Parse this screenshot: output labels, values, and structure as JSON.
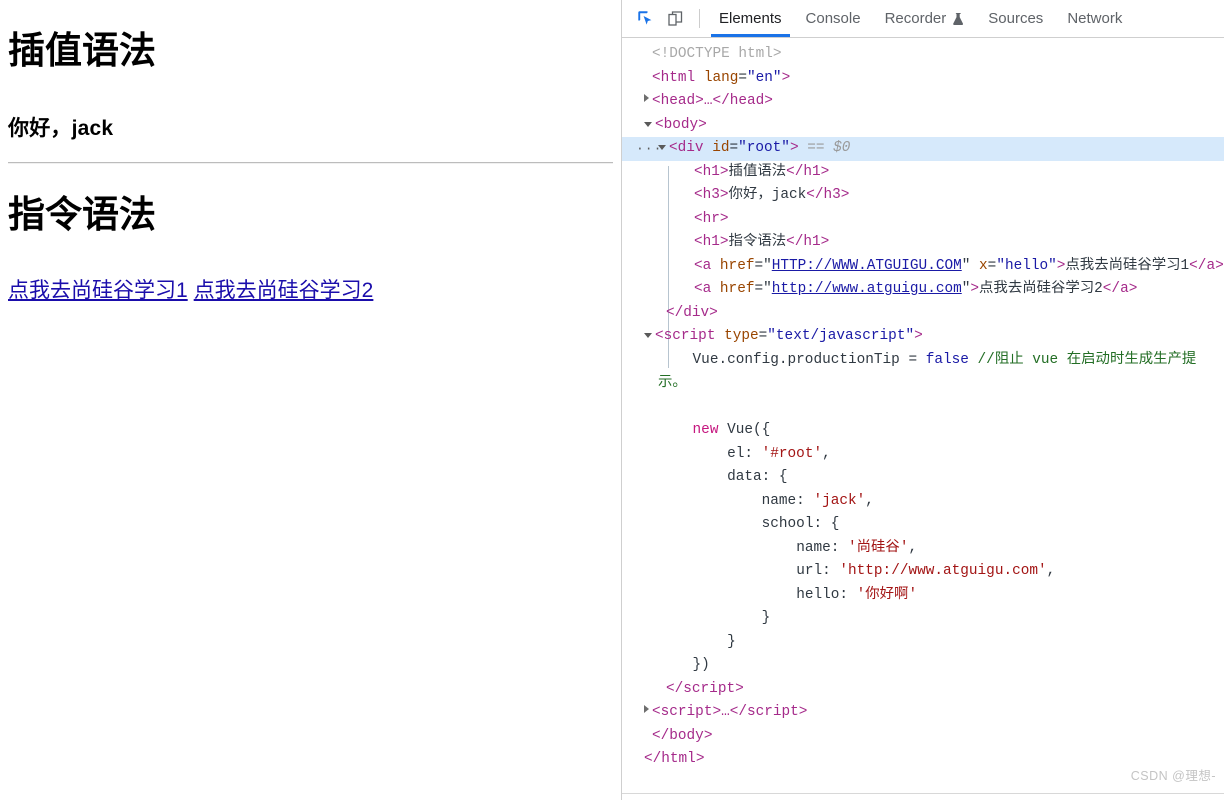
{
  "page": {
    "h1_interpolation": "插值语法",
    "h3_greeting": "你好，jack",
    "h1_directive": "指令语法",
    "link1": "点我去尚硅谷学习1",
    "link2": "点我去尚硅谷学习2"
  },
  "devtools": {
    "toolbar": {
      "inspect_icon": "inspect-cursor-icon",
      "device_icon": "device-toolbar-icon"
    },
    "tabs": [
      {
        "label": "Elements",
        "active": true
      },
      {
        "label": "Console",
        "active": false
      },
      {
        "label": "Recorder",
        "active": false,
        "icon": "flask-icon"
      },
      {
        "label": "Sources",
        "active": false
      },
      {
        "label": "Network",
        "active": false
      }
    ],
    "dom": {
      "doctype": "<!DOCTYPE html>",
      "html_open_tag": "<html",
      "html_attr_name": "lang",
      "html_attr_value": "\"en\"",
      "head_collapsed": "<head>…</head>",
      "body_open": "<body>",
      "selected_badge": "···",
      "div_open_tag": "<div",
      "div_attr_name": "id",
      "div_attr_value": "\"root\"",
      "selected_marker": "== $0",
      "h1_open": "<h1>",
      "h1_text": "插值语法",
      "h1_close": "</h1>",
      "h3_open": "<h3>",
      "h3_text": "你好，jack",
      "h3_close": "</h3>",
      "hr_tag": "<hr>",
      "h1b_open": "<h1>",
      "h1b_text": "指令语法",
      "h1b_close": "</h1>",
      "a1_open": "<a",
      "a1_href_name": "href",
      "a1_href_value": "HTTP://WWW.ATGUIGU.COM",
      "a1_x_name": "x",
      "a1_x_value": "\"hello\"",
      "a1_text": "点我去尚硅谷学习1",
      "a1_close": "</a>",
      "a2_open": "<a",
      "a2_href_name": "href",
      "a2_href_value": "http://www.atguigu.com",
      "a2_text": "点我去尚硅谷学习2",
      "a2_close": "</a>",
      "div_close": "</div>",
      "script_open": "<script",
      "script_attr_name": "type",
      "script_attr_value": "\"text/javascript\"",
      "script_close": "</script>",
      "script2_collapsed": "<script>…</script>",
      "body_close": "</body>",
      "html_close": "</html>"
    },
    "source": {
      "line1_code": "Vue.config.productionTip = ",
      "line1_false": "false",
      "line1_comment": " //阻止 vue 在启动时生成生产提示。",
      "new_kw": "new",
      "new_call": " Vue({",
      "el_key": "el: ",
      "el_val": "'#root'",
      "el_comma": ",",
      "data_key": "data: {",
      "name_key": "name: ",
      "name_val": "'jack'",
      "name_comma": ",",
      "school_key": "school: {",
      "sname_key": "name: ",
      "sname_val": "'尚硅谷'",
      "sname_comma": ",",
      "url_key": "url: ",
      "url_val": "'http://www.atguigu.com'",
      "url_comma": ",",
      "hello_key": "hello: ",
      "hello_val": "'你好啊'",
      "close_school": "}",
      "close_data": "}",
      "close_vue": "})"
    }
  },
  "watermark": "CSDN @理想-",
  "colors": {
    "accent": "#1a73e8",
    "selected_row": "#d6e9fb",
    "tag": "#a52a8a",
    "attr_name": "#994500",
    "attr_value": "#1a1aa6",
    "link": "#1a0dab",
    "comment": "#236e25",
    "string": "#a31515"
  }
}
